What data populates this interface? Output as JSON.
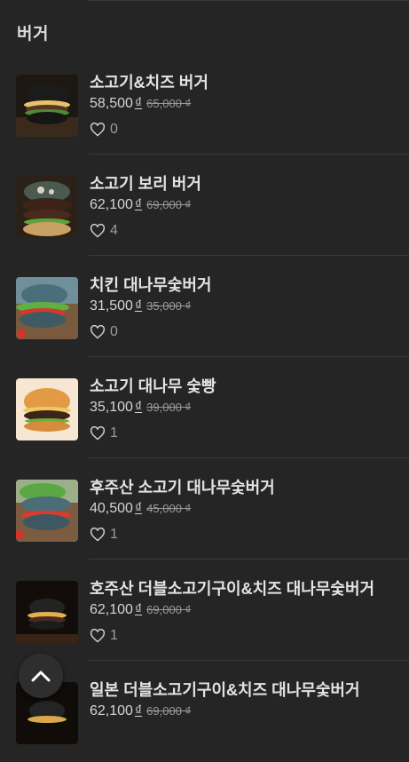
{
  "section": {
    "title": "버거"
  },
  "items": [
    {
      "name": "소고기&치즈 버거",
      "price": "58,500",
      "currency": "₫",
      "old_price": "65,000 ₫",
      "likes": "0",
      "image": "black-bun-cheese-burger"
    },
    {
      "name": "소고기 보리 버거",
      "price": "62,100",
      "currency": "₫",
      "old_price": "69,000 ₫",
      "likes": "4",
      "image": "barley-beef-burger"
    },
    {
      "name": "치킨 대나무숯버거",
      "price": "31,500",
      "currency": "₫",
      "old_price": "35,000 ₫",
      "likes": "0",
      "image": "chicken-charcoal-burger"
    },
    {
      "name": "소고기 대나무 숯빵",
      "price": "35,100",
      "currency": "₫",
      "old_price": "39,000 ₫",
      "likes": "1",
      "image": "beef-burger"
    },
    {
      "name": "후주산 소고기 대나무숯버거",
      "price": "40,500",
      "currency": "₫",
      "old_price": "45,000 ₫",
      "likes": "1",
      "image": "australian-beef-charcoal-burger"
    },
    {
      "name": "호주산 더블소고기구이&치즈 대나무숯버거",
      "price": "62,100",
      "currency": "₫",
      "old_price": "69,000 ₫",
      "likes": "1",
      "image": "double-beef-cheese-charcoal-burger"
    },
    {
      "name": "일본 더블소고기구이&치즈 대나무숯버거",
      "price": "62,100",
      "currency": "₫",
      "old_price": "69,000 ₫",
      "likes": "",
      "image": "japanese-double-beef-charcoal-burger"
    }
  ],
  "icons": {
    "like": "heart-outline-icon",
    "scroll_top": "chevron-up-icon"
  },
  "colors": {
    "background": "#252525",
    "divider": "#3a3a3a",
    "text": "#e3e3e3",
    "muted": "#9c9c9c"
  }
}
